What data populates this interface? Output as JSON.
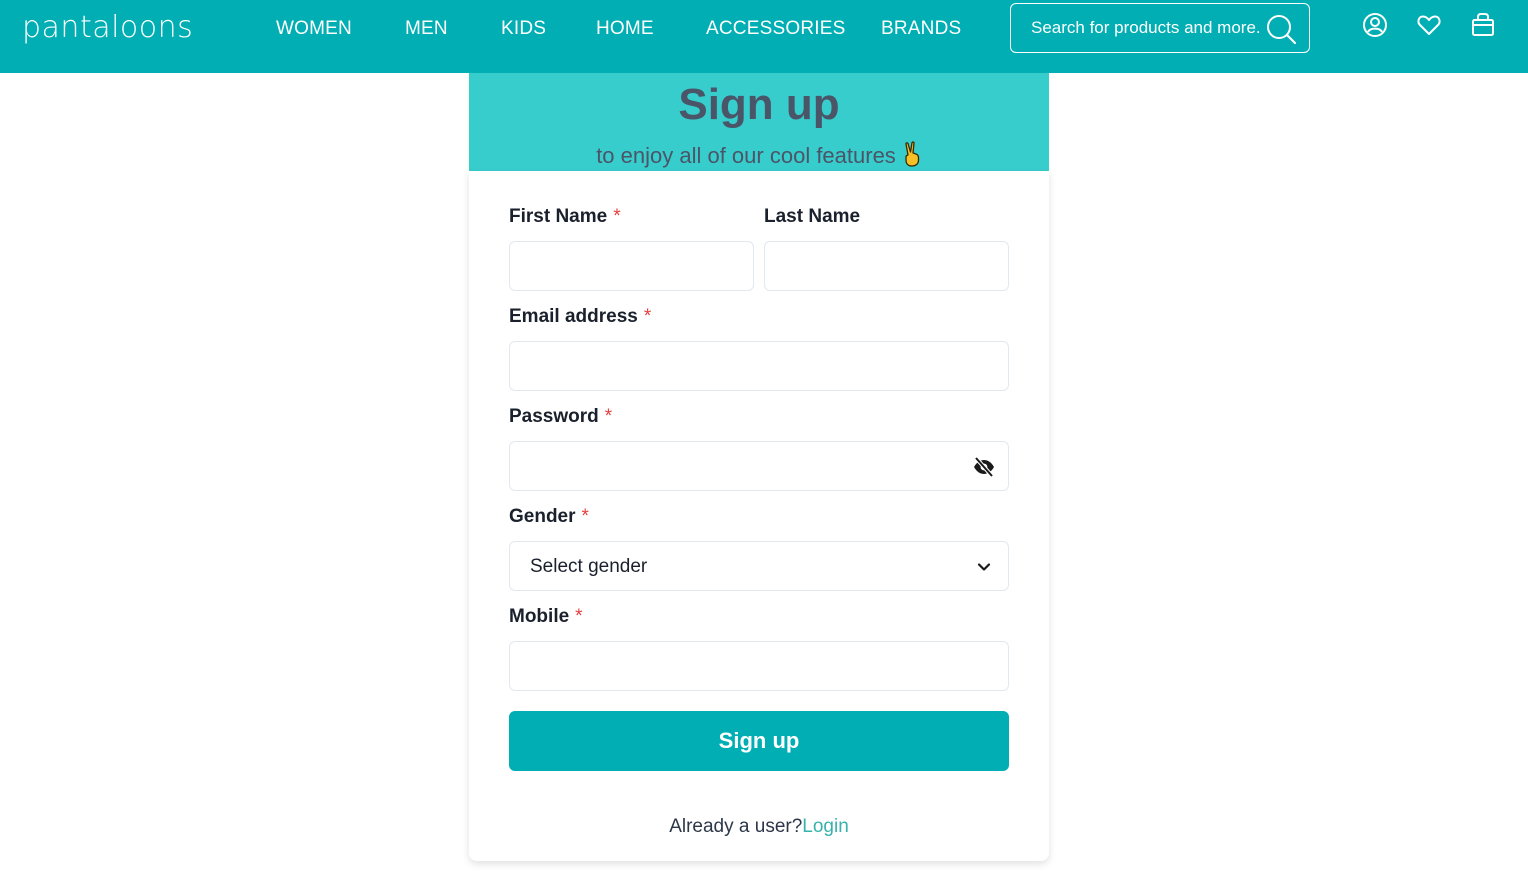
{
  "header": {
    "logo": "pantaloons",
    "nav": [
      "WOMEN",
      "MEN",
      "KIDS",
      "HOME",
      "ACCESSORIES",
      "BRANDS"
    ],
    "search_placeholder": "Search for products and more.",
    "icons": [
      "user-icon",
      "heart-icon",
      "bag-icon"
    ]
  },
  "hero": {
    "title": "Sign up",
    "subtitle": "to enjoy all of our cool features"
  },
  "form": {
    "first_name_label": "First Name",
    "last_name_label": "Last Name",
    "email_label": "Email address",
    "password_label": "Password",
    "gender_label": "Gender",
    "gender_selected": "Select gender",
    "mobile_label": "Mobile",
    "required_mark": "*",
    "submit_label": "Sign up",
    "already_user": "Already a user?",
    "login_link": "Login"
  },
  "colors": {
    "brand": "#00aeb3",
    "hero_bg": "#38cdcd",
    "required": "#e53e3e",
    "link": "#38b2ac"
  }
}
